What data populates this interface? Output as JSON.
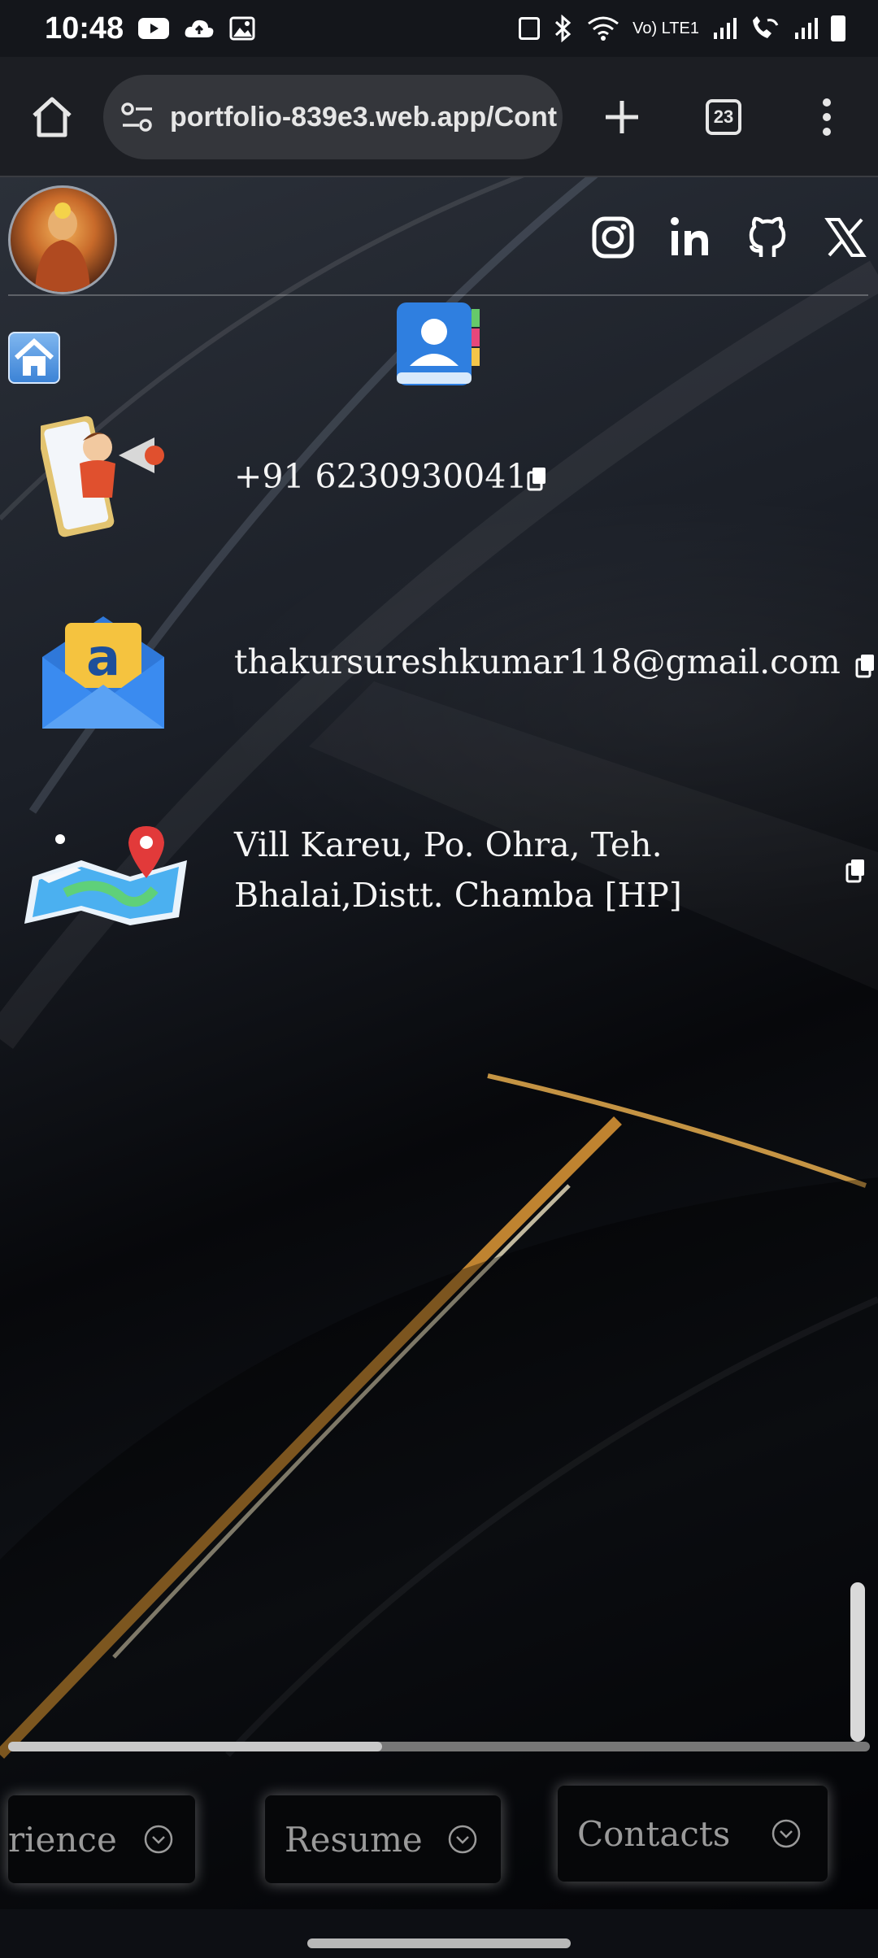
{
  "status_bar": {
    "time": "10:48",
    "icons_left": [
      "youtube-icon",
      "cloud-icon",
      "gallery-icon"
    ],
    "icons_right": [
      "sim-icon",
      "bluetooth-icon",
      "wifi-icon",
      "volte-icon",
      "signal-icon",
      "wifi-call-icon",
      "signal-2-icon",
      "battery-icon"
    ],
    "volte_text": "Vo) LTE1"
  },
  "browser": {
    "url": "portfolio-839e3.web.app/Cont",
    "tab_count": "23"
  },
  "social_links": [
    "instagram-icon",
    "linkedin-icon",
    "github-icon",
    "x-icon"
  ],
  "contacts": {
    "phone": "+91 6230930041",
    "email": "thakursureshkumar118@gmail.com",
    "address_line1": "Vill Kareu, Po. Ohra, Teh.",
    "address_line2": "Bhalai,Distt. Chamba [HP]"
  },
  "nav": {
    "experience": "rience",
    "resume": "Resume",
    "contacts": "Contacts"
  },
  "colors": {
    "page_bg": "#0d0f14",
    "text": "#f5f5f5",
    "nav_text": "#9a9a9a",
    "gold": "#d9a34a"
  }
}
